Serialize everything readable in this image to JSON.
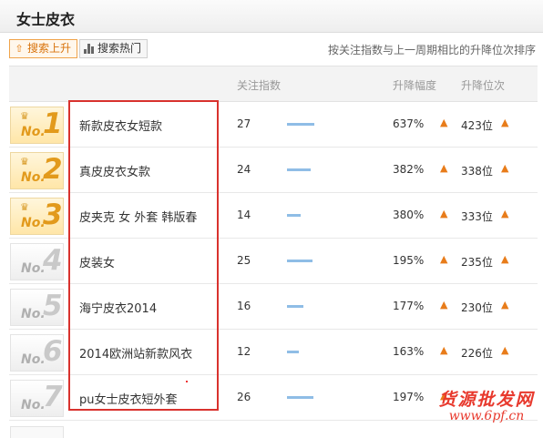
{
  "header": {
    "title": "女士皮衣"
  },
  "tabs": [
    {
      "label": "搜索上升",
      "icon": "upload-arrow-icon",
      "active": true
    },
    {
      "label": "搜索热门",
      "icon": "bar-chart-icon",
      "active": false
    }
  ],
  "note": "按关注指数与上一周期相比的升降位次排序",
  "columns": {
    "attention_index": "关注指数",
    "rise_rate": "升降幅度",
    "rise_rank": "升降位次"
  },
  "rows": [
    {
      "no": "No.",
      "num": "1",
      "keyword": "新款皮衣女短款",
      "index": "27",
      "bar_level": 27,
      "rate": "637%",
      "rank": "423位"
    },
    {
      "no": "No.",
      "num": "2",
      "keyword": "真皮皮衣女款",
      "index": "24",
      "bar_level": 24,
      "rate": "382%",
      "rank": "338位"
    },
    {
      "no": "No.",
      "num": "3",
      "keyword": "皮夹克 女 外套 韩版春",
      "index": "14",
      "bar_level": 14,
      "rate": "380%",
      "rank": "333位"
    },
    {
      "no": "No.",
      "num": "4",
      "keyword": "皮装女",
      "index": "25",
      "bar_level": 25,
      "rate": "195%",
      "rank": "235位"
    },
    {
      "no": "No.",
      "num": "5",
      "keyword": "海宁皮衣2014",
      "index": "16",
      "bar_level": 16,
      "rate": "177%",
      "rank": "230位"
    },
    {
      "no": "No.",
      "num": "6",
      "keyword": "2014欧洲站新款风衣",
      "index": "12",
      "bar_level": 12,
      "rate": "163%",
      "rank": "226位"
    },
    {
      "no": "No.",
      "num": "7",
      "keyword": "pu女士皮衣短外套",
      "index": "26",
      "bar_level": 26,
      "rate": "197%",
      "rank": ""
    }
  ],
  "watermark": {
    "name": "货源批发网",
    "url": "www.6pf.cn"
  },
  "colors": {
    "accent": "#e87c1a",
    "highlight_box": "#d9322e",
    "bar": "#8fbde6",
    "watermark": "#e8392d"
  }
}
